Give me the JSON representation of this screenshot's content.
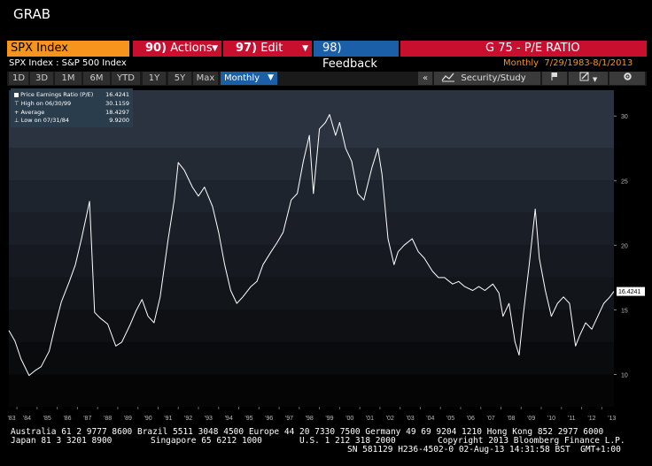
{
  "app": {
    "grab_label": "GRAB"
  },
  "header": {
    "ticker": "SPX Index",
    "actions": {
      "num": "90)",
      "label": "Actions"
    },
    "edit": {
      "num": "97)",
      "label": "Edit"
    },
    "feedback": {
      "num": "98)",
      "label": "Feedback"
    },
    "function_title": "G 75 - P/E RATIO"
  },
  "subheader": {
    "security": "SPX Index : S&P 500 Index",
    "frequency": "Monthly",
    "date_range": "7/29/1983-8/1/2013"
  },
  "toolbar": {
    "ranges": [
      "1D",
      "3D",
      "1M",
      "6M",
      "YTD",
      "1Y",
      "5Y",
      "Max"
    ],
    "period_select": "Monthly",
    "collapse": "«",
    "security_study": "Security/Study"
  },
  "legend": {
    "series_label": "Price Earnings Ratio (P/E)",
    "series_value": "16.4241",
    "high_label": "High on 06/30/99",
    "high_value": "30.1159",
    "average_label": "Average",
    "average_value": "18.4297",
    "low_label": "Low on 07/31/84",
    "low_value": "9.9200"
  },
  "colors": {
    "accent_orange": "#f7941d",
    "menu_red": "#c8102e",
    "feedback_blue": "#1b5fa8",
    "line": "#ffffff"
  },
  "chart_data": {
    "type": "line",
    "xlabel": "",
    "ylabel": "",
    "x_ticks": [
      "'83",
      "'84",
      "'85",
      "'86",
      "'87",
      "'88",
      "'89",
      "'90",
      "'91",
      "'92",
      "'93",
      "'94",
      "'95",
      "'96",
      "'97",
      "'98",
      "'99",
      "'00",
      "'01",
      "'02",
      "'03",
      "'04",
      "'05",
      "'06",
      "'07",
      "'08",
      "'09",
      "'10",
      "'11",
      "'12",
      "'13"
    ],
    "y_ticks": [
      10,
      15,
      20,
      25,
      30
    ],
    "ylim": [
      7.5,
      32
    ],
    "xlim": [
      1983.6,
      2013.6
    ],
    "last_value_label": "16.4241",
    "series": [
      {
        "values_xy": [
          [
            1983.6,
            13.4
          ],
          [
            1983.9,
            12.6
          ],
          [
            1984.2,
            11.2
          ],
          [
            1984.6,
            9.92
          ],
          [
            1984.9,
            10.3
          ],
          [
            1985.2,
            10.6
          ],
          [
            1985.6,
            11.8
          ],
          [
            1985.9,
            13.8
          ],
          [
            1986.2,
            15.6
          ],
          [
            1986.6,
            17.2
          ],
          [
            1986.9,
            18.5
          ],
          [
            1987.2,
            20.5
          ],
          [
            1987.6,
            23.4
          ],
          [
            1987.85,
            14.8
          ],
          [
            1988.1,
            14.4
          ],
          [
            1988.5,
            13.9
          ],
          [
            1988.9,
            12.2
          ],
          [
            1989.2,
            12.5
          ],
          [
            1989.6,
            13.8
          ],
          [
            1989.9,
            14.9
          ],
          [
            1990.2,
            15.8
          ],
          [
            1990.5,
            14.5
          ],
          [
            1990.8,
            14.0
          ],
          [
            1991.1,
            16.0
          ],
          [
            1991.5,
            20.5
          ],
          [
            1991.8,
            23.5
          ],
          [
            1992.0,
            26.4
          ],
          [
            1992.3,
            25.8
          ],
          [
            1992.7,
            24.5
          ],
          [
            1993.0,
            23.8
          ],
          [
            1993.3,
            24.5
          ],
          [
            1993.7,
            23.0
          ],
          [
            1994.0,
            21.0
          ],
          [
            1994.3,
            18.5
          ],
          [
            1994.6,
            16.5
          ],
          [
            1994.9,
            15.5
          ],
          [
            1995.2,
            16.0
          ],
          [
            1995.6,
            16.8
          ],
          [
            1995.9,
            17.2
          ],
          [
            1996.2,
            18.5
          ],
          [
            1996.6,
            19.5
          ],
          [
            1996.9,
            20.2
          ],
          [
            1997.2,
            21.0
          ],
          [
            1997.6,
            23.5
          ],
          [
            1997.9,
            24.0
          ],
          [
            1998.2,
            26.5
          ],
          [
            1998.5,
            28.5
          ],
          [
            1998.7,
            24.0
          ],
          [
            1999.0,
            29.0
          ],
          [
            1999.3,
            29.5
          ],
          [
            1999.5,
            30.1159
          ],
          [
            1999.8,
            28.5
          ],
          [
            2000.0,
            29.5
          ],
          [
            2000.3,
            27.5
          ],
          [
            2000.6,
            26.5
          ],
          [
            2000.9,
            24.0
          ],
          [
            2001.2,
            23.5
          ],
          [
            2001.6,
            26.0
          ],
          [
            2001.9,
            27.5
          ],
          [
            2002.1,
            25.5
          ],
          [
            2002.4,
            20.5
          ],
          [
            2002.7,
            18.5
          ],
          [
            2002.9,
            19.5
          ],
          [
            2003.2,
            20.0
          ],
          [
            2003.6,
            20.5
          ],
          [
            2003.9,
            19.5
          ],
          [
            2004.2,
            19.0
          ],
          [
            2004.6,
            18.0
          ],
          [
            2004.9,
            17.5
          ],
          [
            2005.2,
            17.5
          ],
          [
            2005.6,
            17.0
          ],
          [
            2005.9,
            17.2
          ],
          [
            2006.2,
            16.8
          ],
          [
            2006.6,
            16.5
          ],
          [
            2006.9,
            16.8
          ],
          [
            2007.2,
            16.5
          ],
          [
            2007.6,
            17.0
          ],
          [
            2007.9,
            16.3
          ],
          [
            2008.1,
            14.5
          ],
          [
            2008.4,
            15.5
          ],
          [
            2008.7,
            12.5
          ],
          [
            2008.9,
            11.5
          ],
          [
            2009.1,
            14.5
          ],
          [
            2009.4,
            18.5
          ],
          [
            2009.7,
            22.8
          ],
          [
            2009.9,
            19.0
          ],
          [
            2010.2,
            16.5
          ],
          [
            2010.5,
            14.5
          ],
          [
            2010.8,
            15.5
          ],
          [
            2011.1,
            16.0
          ],
          [
            2011.4,
            15.5
          ],
          [
            2011.7,
            12.2
          ],
          [
            2011.9,
            13.0
          ],
          [
            2012.2,
            14.0
          ],
          [
            2012.5,
            13.5
          ],
          [
            2012.8,
            14.5
          ],
          [
            2013.1,
            15.5
          ],
          [
            2013.4,
            16.0
          ],
          [
            2013.6,
            16.4241
          ]
        ]
      }
    ]
  },
  "footer": {
    "line1": "Australia 61 2 9777 8600 Brazil 5511 3048 4500 Europe 44 20 7330 7500 Germany 49 69 9204 1210 Hong Kong 852 2977 6000",
    "line2_left": "Japan 81 3 3201 8900",
    "line2_mid": "Singapore 65 6212 1000",
    "line2_us": "U.S. 1 212 318 2000",
    "line2_right": "Copyright 2013 Bloomberg Finance L.P.",
    "line3": "SN 581129 H236-4502-0 02-Aug-13 14:31:58 BST  GMT+1:00"
  }
}
